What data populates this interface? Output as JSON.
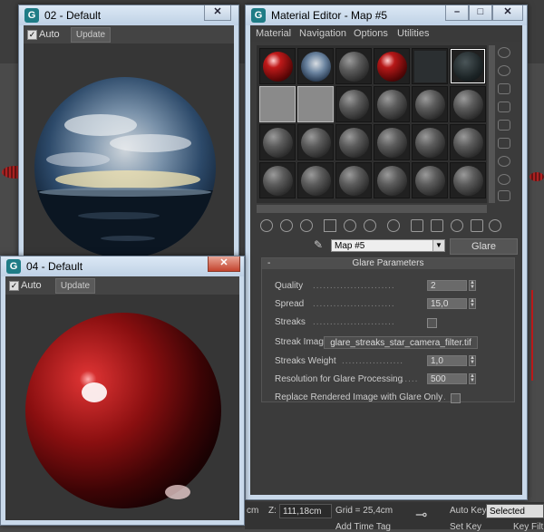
{
  "window_02": {
    "title": "02 - Default",
    "auto_label": "Auto",
    "update_label": "Update"
  },
  "window_04": {
    "title": "04 - Default",
    "auto_label": "Auto",
    "update_label": "Update"
  },
  "material_editor": {
    "title": "Material Editor - Map #5",
    "menu": [
      "Material",
      "Navigation",
      "Options",
      "Utilities"
    ],
    "map_name": "Map #5",
    "map_type": "Glare",
    "rollout_title": "Glare Parameters",
    "params": {
      "quality_label": "Quality",
      "quality_value": "2",
      "spread_label": "Spread",
      "spread_value": "15,0",
      "streaks_label": "Streaks",
      "streak_image_label": "Streak Image",
      "streak_image_file": "glare_streaks_star_camera_filter.tif",
      "streaks_weight_label": "Streaks Weight",
      "streaks_weight_value": "1,0",
      "resolution_label": "Resolution for Glare Processing",
      "resolution_value": "500",
      "replace_label": "Replace Rendered Image with Glare Only"
    }
  },
  "statusbar": {
    "z_label": "Z:",
    "z_value": "111,18cm",
    "grid_text": "Grid = 25,4cm",
    "auto_key": "Auto Key",
    "selected": "Selected",
    "add_time_tag": "Add Time Tag",
    "set_key": "Set Key",
    "key_filters": "Key Filt",
    "partial_x": "cm"
  },
  "colors": {
    "title_bar": "#c9d9ea",
    "panel": "#3b3b3b",
    "accent_red": "#c01a1a"
  }
}
